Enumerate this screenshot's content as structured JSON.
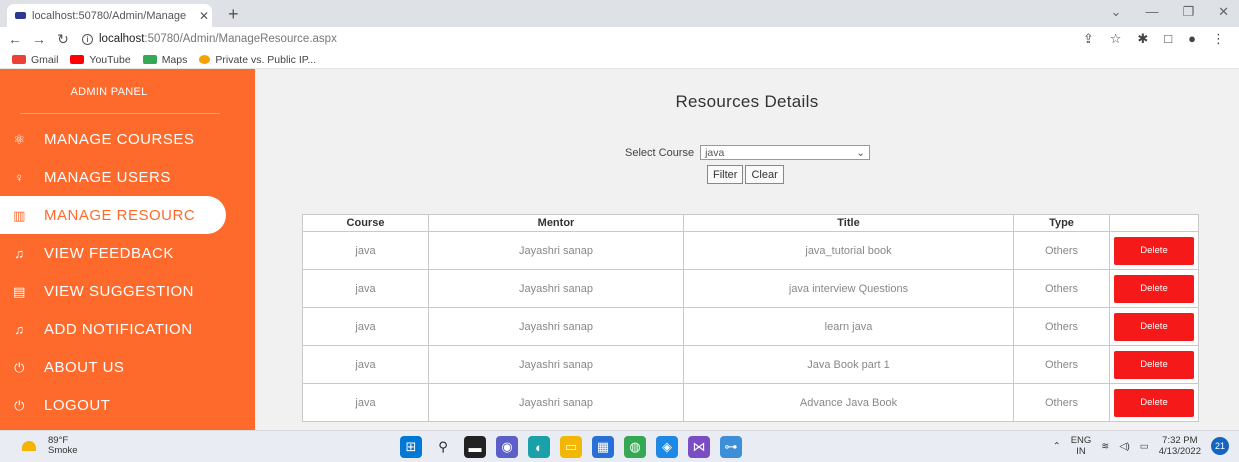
{
  "browser": {
    "tab_title": "localhost:50780/Admin/Manage",
    "url_host": "localhost",
    "url_path": ":50780/Admin/ManageResource.aspx",
    "bookmarks": [
      {
        "label": "Gmail",
        "color": "#ea4335"
      },
      {
        "label": "YouTube",
        "color": "#ff0000"
      },
      {
        "label": "Maps",
        "color": "#34a853"
      },
      {
        "label": "Private vs. Public IP...",
        "color": "#f4a300"
      }
    ]
  },
  "sidebar": {
    "brand": "ADMIN PANEL",
    "items": [
      {
        "label": "MANAGE COURSES",
        "icon": "⚛"
      },
      {
        "label": "MANAGE USERS",
        "icon": "♀"
      },
      {
        "label": "MANAGE RESOURC",
        "icon": "▥"
      },
      {
        "label": "VIEW FEEDBACK",
        "icon": "♫"
      },
      {
        "label": "VIEW SUGGESTION",
        "icon": "▤"
      },
      {
        "label": "ADD NOTIFICATION",
        "icon": "♫"
      },
      {
        "label": "ABOUT US",
        "icon": "⏻"
      },
      {
        "label": "LOGOUT",
        "icon": "⏻"
      }
    ]
  },
  "main": {
    "heading": "Resources Details",
    "filter_label": "Select Course",
    "selected_course": "java",
    "filter_button": "Filter",
    "clear_button": "Clear"
  },
  "table": {
    "headers": [
      "Course",
      "Mentor",
      "Title",
      "Type",
      ""
    ],
    "rows": [
      {
        "course": "java",
        "mentor": "Jayashri sanap",
        "title": "java_tutorial book",
        "type": "Others",
        "action": "Delete"
      },
      {
        "course": "java",
        "mentor": "Jayashri sanap",
        "title": "java interview Questions",
        "type": "Others",
        "action": "Delete"
      },
      {
        "course": "java",
        "mentor": "Jayashri sanap",
        "title": "learn java",
        "type": "Others",
        "action": "Delete"
      },
      {
        "course": "java",
        "mentor": "Jayashri sanap",
        "title": "Java Book part 1",
        "type": "Others",
        "action": "Delete"
      },
      {
        "course": "java",
        "mentor": "Jayashri sanap",
        "title": "Advance Java Book",
        "type": "Others",
        "action": "Delete"
      }
    ]
  },
  "taskbar": {
    "temperature": "89°F",
    "weather": "Smoke",
    "lang_top": "ENG",
    "lang_bottom": "IN",
    "time": "7:32 PM",
    "date": "4/13/2022",
    "notification_count": "21"
  },
  "colors": {
    "sidebar": "#fe6a2c",
    "delete_button": "#f51919"
  }
}
